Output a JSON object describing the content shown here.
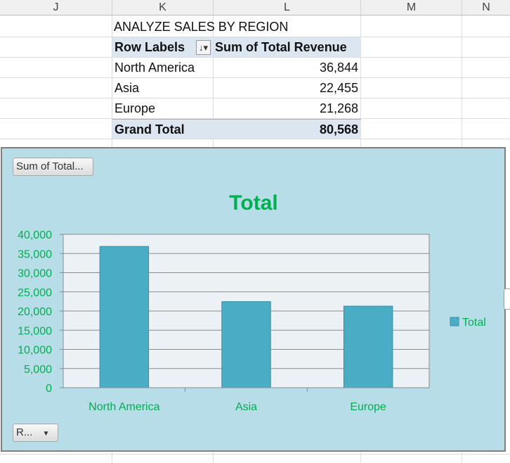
{
  "columns": [
    "J",
    "K",
    "L",
    "M",
    "N"
  ],
  "pivot": {
    "title": "ANALYZE SALES BY REGION",
    "header_labels": "Row Labels",
    "header_value": "Sum of Total Revenue",
    "rows": [
      {
        "label": "North America",
        "value": "36,844"
      },
      {
        "label": "Asia",
        "value": "22,455"
      },
      {
        "label": "Europe",
        "value": "21,268"
      }
    ],
    "total_label": "Grand Total",
    "total_value": "80,568"
  },
  "chart_buttons": {
    "value_field": "Sum of Total...",
    "axis_field": "R..."
  },
  "colors": {
    "bar": "#4bacc6",
    "chart_background": "#b7dde8",
    "plot_background": "#ebf1f4",
    "accent_green": "#00b050"
  },
  "chart_data": {
    "type": "bar",
    "title": "Total",
    "categories": [
      "North America",
      "Asia",
      "Europe"
    ],
    "series": [
      {
        "name": "Total",
        "values": [
          36844,
          22455,
          21268
        ]
      }
    ],
    "ylim": [
      0,
      40000
    ],
    "yticks": [
      "0",
      "5,000",
      "10,000",
      "15,000",
      "20,000",
      "25,000",
      "30,000",
      "35,000",
      "40,000"
    ],
    "grid": true,
    "legend": "right"
  }
}
